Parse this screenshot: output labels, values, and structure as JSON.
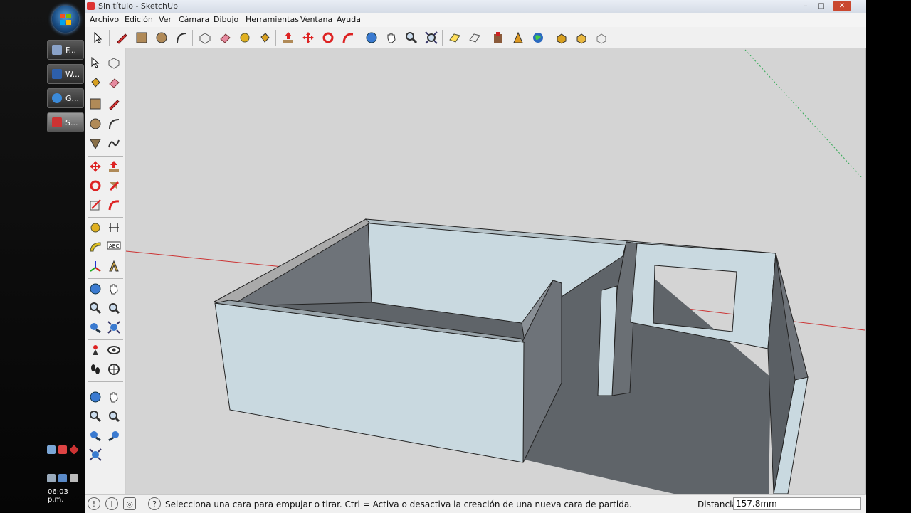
{
  "window": {
    "title": "Sin título - SketchUp"
  },
  "menu": [
    "Archivo",
    "Edición",
    "Ver",
    "Cámara",
    "Dibujo",
    "Herramientas",
    "Ventana",
    "Ayuda"
  ],
  "taskbar": {
    "items": [
      {
        "label": "F...",
        "icon": "folder-icon"
      },
      {
        "label": "W...",
        "icon": "word-icon"
      },
      {
        "label": "G...",
        "icon": "ie-icon"
      },
      {
        "label": "S...",
        "icon": "sketchup-icon"
      }
    ],
    "clock": "06:03 p.m."
  },
  "status": {
    "message": "Selecciona una cara para empujar o tirar. Ctrl = Activa o desactiva la creación de una nueva cara de partida.",
    "measure_label": "Distancia",
    "measure_value": "157.8mm"
  },
  "colors": {
    "viewport_bg": "#d4d4d4",
    "wall_light": "#c9d9e0",
    "wall_dark": "#6e7379",
    "floor": "#6a6f74",
    "red_axis": "#cc3333",
    "green_axis": "#33aa55"
  }
}
